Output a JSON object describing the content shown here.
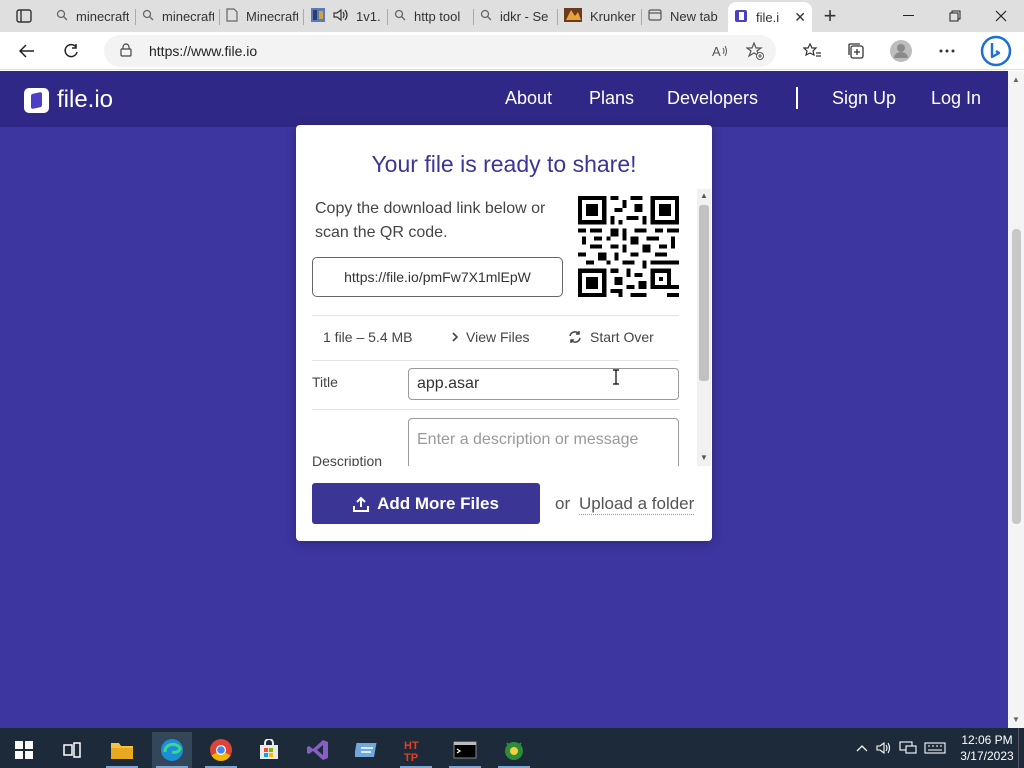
{
  "browser": {
    "tabs": [
      {
        "label": "minecraft",
        "icon": "search-icon"
      },
      {
        "label": "minecraft",
        "icon": "search-icon"
      },
      {
        "label": "Minecraft",
        "icon": "page-icon"
      },
      {
        "label": "1v1.",
        "icon": "game-icon"
      },
      {
        "label": "http tool",
        "icon": "search-icon"
      },
      {
        "label": "idkr - Se",
        "icon": "search-icon"
      },
      {
        "label": "Krunker",
        "icon": "krunker-icon"
      },
      {
        "label": "New tab",
        "icon": "newtab-icon"
      },
      {
        "label": "file.i",
        "icon": "fileio-icon"
      }
    ],
    "url": "https://www.file.io"
  },
  "site": {
    "logo_text": "file.io",
    "nav": [
      "About",
      "Plans",
      "Developers",
      "Sign Up",
      "Log In"
    ]
  },
  "card": {
    "title": "Your file is ready to share!",
    "copy_text": "Copy the download link below or scan the QR code.",
    "link": "https://file.io/pmFw7X1mlEpW",
    "file_info": "1 file – 5.4 MB",
    "view_files": "View Files",
    "start_over": "Start Over",
    "title_label": "Title",
    "title_value": "app.asar",
    "description_label": "Description",
    "description_placeholder": "Enter a description or message",
    "add_more": "Add More Files",
    "or": "or",
    "upload_folder": "Upload a folder"
  },
  "taskbar": {
    "time": "12:06 PM",
    "date": "3/17/2023"
  },
  "colors": {
    "page_bg": "#3d35a0",
    "nav_bg": "#302886",
    "accent": "#3b3596"
  }
}
